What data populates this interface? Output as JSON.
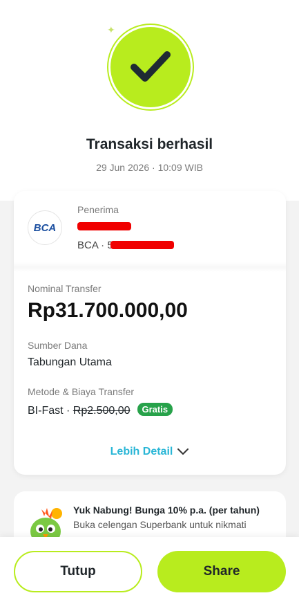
{
  "status": {
    "title": "Transaksi berhasil",
    "datetime": "29 Jun 2026 · 10:09 WIB"
  },
  "recipient": {
    "label": "Penerima",
    "bank_logo_text": "BCA",
    "bank_line": "BCA · 5"
  },
  "transfer": {
    "amount_label": "Nominal Transfer",
    "amount": "Rp31.700.000,00",
    "source_label": "Sumber Dana",
    "source": "Tabungan Utama",
    "method_label": "Metode & Biaya Transfer",
    "method": "BI-Fast · ",
    "fee_original": "Rp2.500,00",
    "fee_badge": "Gratis",
    "detail_link": "Lebih Detail"
  },
  "promo": {
    "title": "Yuk Nabung! Bunga 10% p.a. (per tahun)",
    "description": "Buka celengan Superbank untuk nikmati"
  },
  "buttons": {
    "close": "Tutup",
    "share": "Share"
  },
  "colors": {
    "accent": "#b8ec1e",
    "link": "#29b6d6",
    "badge": "#27a24a",
    "redaction": "#f00000"
  }
}
